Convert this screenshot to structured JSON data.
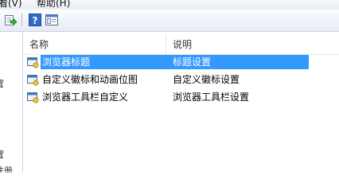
{
  "menubar": {
    "items": [
      {
        "label": "看(V)"
      },
      {
        "label": "帮助(H)"
      }
    ]
  },
  "toolbar": {
    "buttons": [
      {
        "icon": "export-icon"
      },
      {
        "icon": "help-icon"
      },
      {
        "icon": "properties-icon"
      }
    ]
  },
  "left_panel": {
    "fragments": [
      "置",
      "置",
      "注册"
    ]
  },
  "list": {
    "columns": [
      {
        "label": "名称"
      },
      {
        "label": "说明"
      }
    ],
    "rows": [
      {
        "name": "浏览器标题",
        "description": "标题设置",
        "selected": true
      },
      {
        "name": "自定义徽标和动画位图",
        "description": "自定义徽标设置",
        "selected": false
      },
      {
        "name": "浏览器工具栏自定义",
        "description": "浏览器工具栏设置",
        "selected": false
      }
    ]
  },
  "colors": {
    "selection": "#3399ff",
    "toolbar_bg": "#e6ecf5"
  }
}
